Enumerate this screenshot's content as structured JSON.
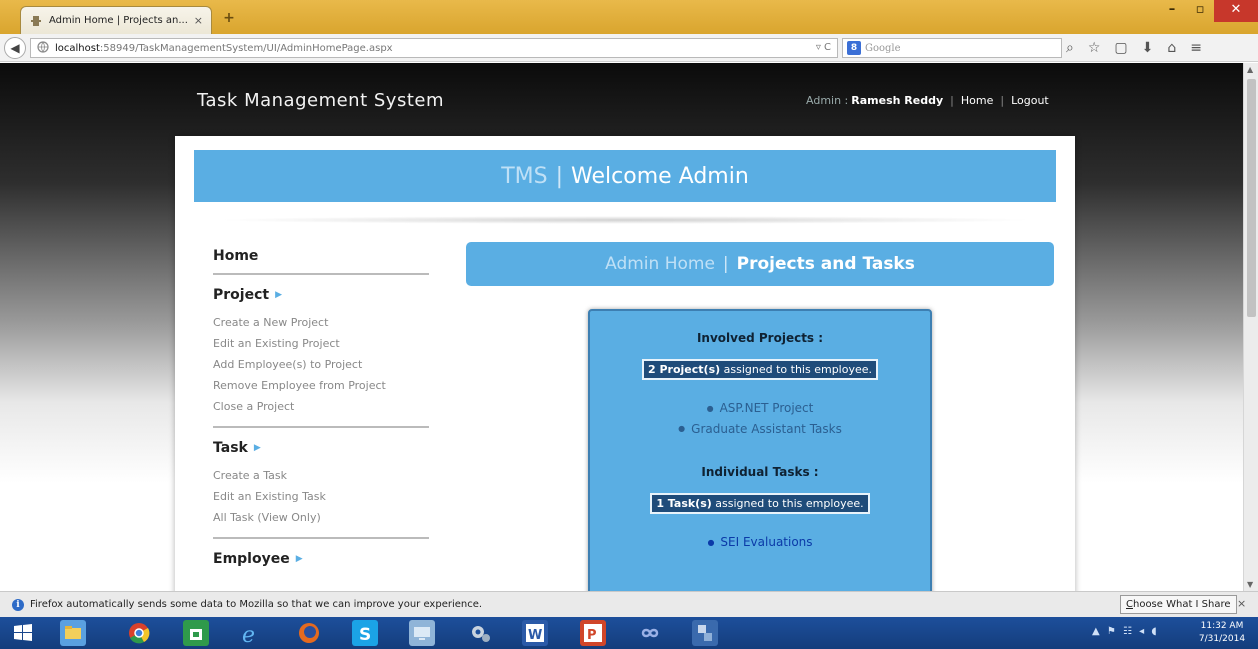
{
  "browser": {
    "tab_title": "Admin Home | Projects an...",
    "tab_close": "×",
    "new_tab": "+",
    "url_prefix": "localhost",
    "url_rest": ":58949/TaskManagementSystem/UI/AdminHomePage.aspx",
    "url_controls": "▿ C",
    "search_engine_mark": "8",
    "search_placeholder": "Google",
    "toolbar_icons": [
      "search-icon",
      "star-icon",
      "clipboard-icon",
      "download-icon",
      "home-icon",
      "menu-icon"
    ],
    "window_controls": [
      "minimize-icon",
      "maximize-icon",
      "close-icon"
    ]
  },
  "site": {
    "title": "Task Management System",
    "role_label": "Admin :",
    "user_name": "Ramesh Reddy",
    "separator": "|",
    "nav_home": "Home",
    "nav_logout": "Logout"
  },
  "banner": {
    "prefix": "TMS",
    "separator": "|",
    "title": "Welcome Admin"
  },
  "sidebar": {
    "home": "Home",
    "sections": [
      {
        "heading": "Project",
        "links": [
          "Create a New Project",
          "Edit an Existing Project",
          "Add Employee(s) to Project",
          "Remove Employee from Project",
          "Close a Project"
        ]
      },
      {
        "heading": "Task",
        "links": [
          "Create a Task",
          "Edit an Existing Task",
          "All Task (View Only)"
        ]
      },
      {
        "heading": "Employee",
        "links": []
      }
    ]
  },
  "subbanner": {
    "prefix": "Admin Home",
    "separator": "|",
    "title": "Projects and Tasks"
  },
  "infobox": {
    "projects_heading": "Involved Projects :",
    "projects_count": "2 Project(s)",
    "projects_suffix": " assigned to this employee.",
    "projects": [
      "ASP.NET Project",
      "Graduate Assistant Tasks"
    ],
    "tasks_heading": "Individual Tasks :",
    "tasks_count": "1 Task(s)",
    "tasks_suffix": " assigned to this employee.",
    "tasks": [
      "SEI Evaluations"
    ]
  },
  "notification": {
    "text": "Firefox automatically sends some data to Mozilla so that we can improve your experience.",
    "button_underlined": "C",
    "button_rest": "hoose What I Share",
    "close": "×"
  },
  "taskbar": {
    "apps": [
      "windows-start-icon",
      "file-explorer-icon",
      "chrome-icon",
      "store-icon",
      "internet-explorer-icon",
      "firefox-icon",
      "skype-icon",
      "remote-desktop-icon",
      "settings-icon",
      "word-icon",
      "powerpoint-icon",
      "infinity-app-icon",
      "network-tool-icon"
    ],
    "tray": "▲ ⚑ ☷ ◂ ◖",
    "time": "11:32 AM",
    "date": "7/31/2014"
  }
}
